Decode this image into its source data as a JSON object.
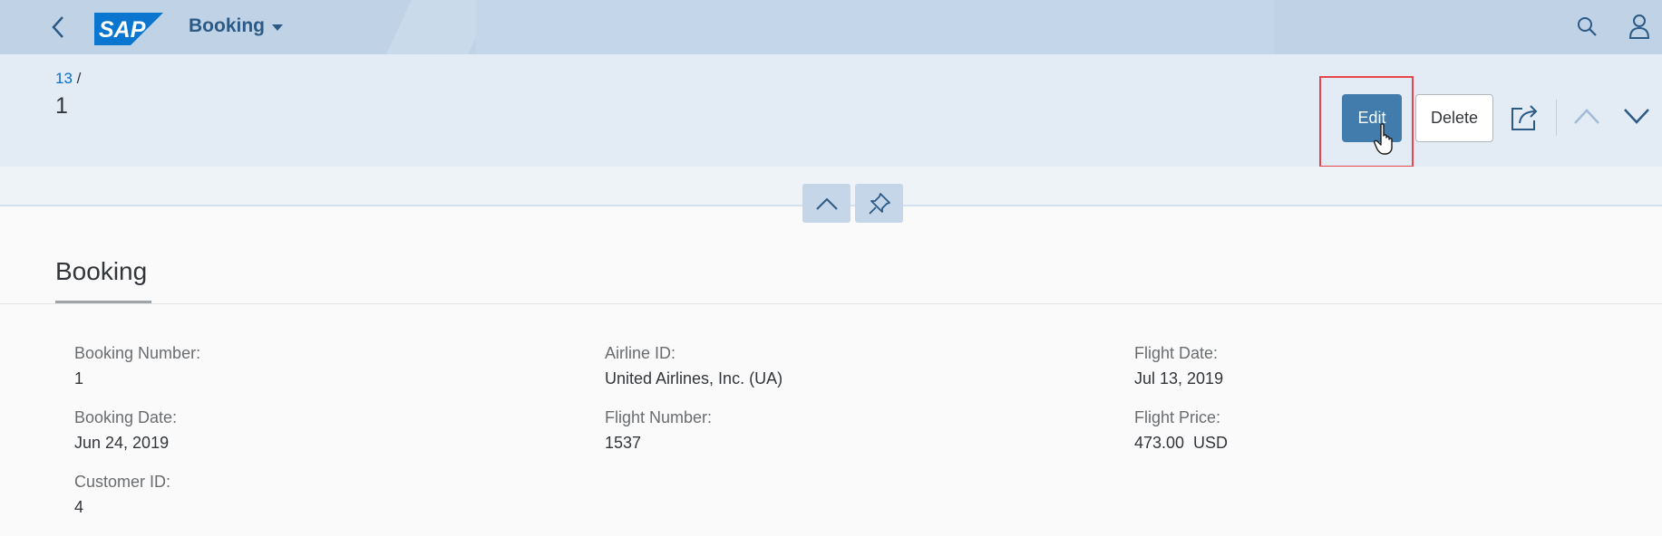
{
  "shell": {
    "app_title": "Booking",
    "logo_text": "SAP",
    "icons": {
      "back": "back-icon",
      "app_menu": "chevron-down-icon",
      "search": "search-icon",
      "user": "user-icon"
    }
  },
  "header": {
    "breadcrumb_link": "13",
    "breadcrumb_separator": "/",
    "title": "1",
    "actions": {
      "edit_label": "Edit",
      "delete_label": "Delete"
    },
    "icons": {
      "share": "share-icon",
      "previous": "chevron-up-icon",
      "next": "chevron-down-icon"
    }
  },
  "strip": {
    "icons": {
      "collapse": "chevron-up-icon",
      "pin": "pin-icon"
    }
  },
  "section": {
    "title": "Booking",
    "fields": [
      {
        "label": "Booking Number:",
        "value": "1"
      },
      {
        "label": "Booking Date:",
        "value": "Jun 24, 2019"
      },
      {
        "label": "Customer ID:",
        "value": "4"
      },
      {
        "label": "Airline ID:",
        "value": "United Airlines, Inc. (UA)"
      },
      {
        "label": "Flight Number:",
        "value": "1537"
      },
      {
        "label": "Flight Date:",
        "value": "Jul 13, 2019"
      },
      {
        "label": "Flight Price:",
        "value": "473.00  USD"
      }
    ]
  },
  "colors": {
    "shell_background": "#c0d3e6",
    "header_background": "#e3ebf4",
    "emphasized_button": "#427cac",
    "link": "#0a6ed1",
    "highlight_box": "#e8464c",
    "sap_logo": "#0a76d0"
  }
}
